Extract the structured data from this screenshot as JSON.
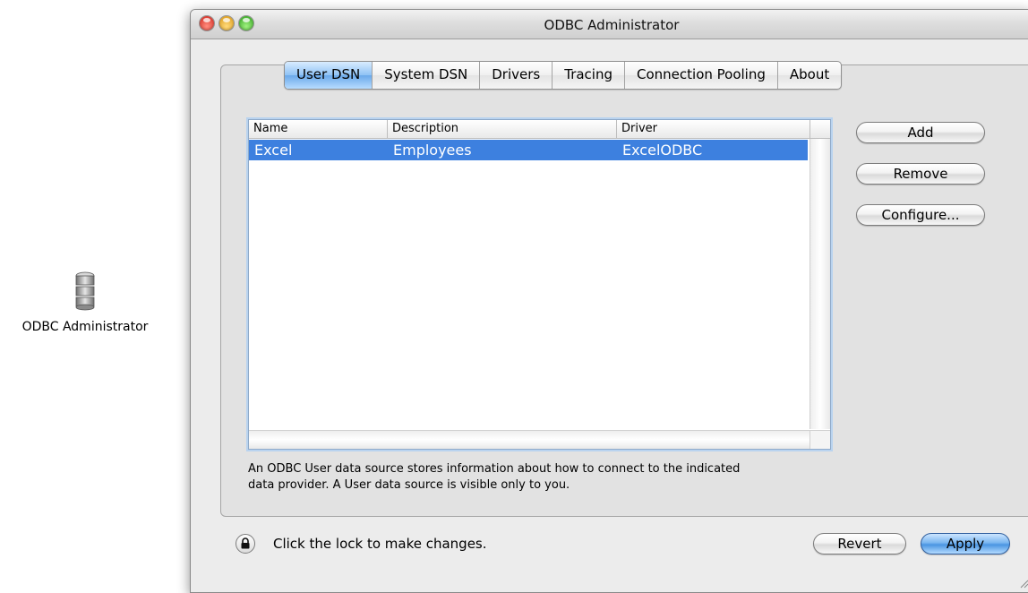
{
  "desktop": {
    "icon_label": "ODBC Administrator"
  },
  "window": {
    "title": "ODBC Administrator"
  },
  "tabs": [
    {
      "label": "User DSN",
      "active": true
    },
    {
      "label": "System DSN",
      "active": false
    },
    {
      "label": "Drivers",
      "active": false
    },
    {
      "label": "Tracing",
      "active": false
    },
    {
      "label": "Connection Pooling",
      "active": false
    },
    {
      "label": "About",
      "active": false
    }
  ],
  "table": {
    "columns": [
      "Name",
      "Description",
      "Driver"
    ],
    "rows": [
      {
        "name": "Excel",
        "description": "Employees",
        "driver": "ExcelODBC",
        "selected": true
      }
    ]
  },
  "side_buttons": {
    "add": "Add",
    "remove": "Remove",
    "configure": "Configure..."
  },
  "description": {
    "line1": "An ODBC User data source stores information about how to connect to the indicated",
    "line2": "data provider. A User data source is visible only to you."
  },
  "footer": {
    "lock_text": "Click the lock to make changes.",
    "revert": "Revert",
    "apply": "Apply"
  },
  "icons": {
    "desktop_icon": "database-icon",
    "lock": "lock-icon",
    "resize": "resize-grip-icon"
  },
  "colors": {
    "selection": "#3d80df",
    "active_tab": "#8fc2f5",
    "default_button": "#4a95e2"
  }
}
